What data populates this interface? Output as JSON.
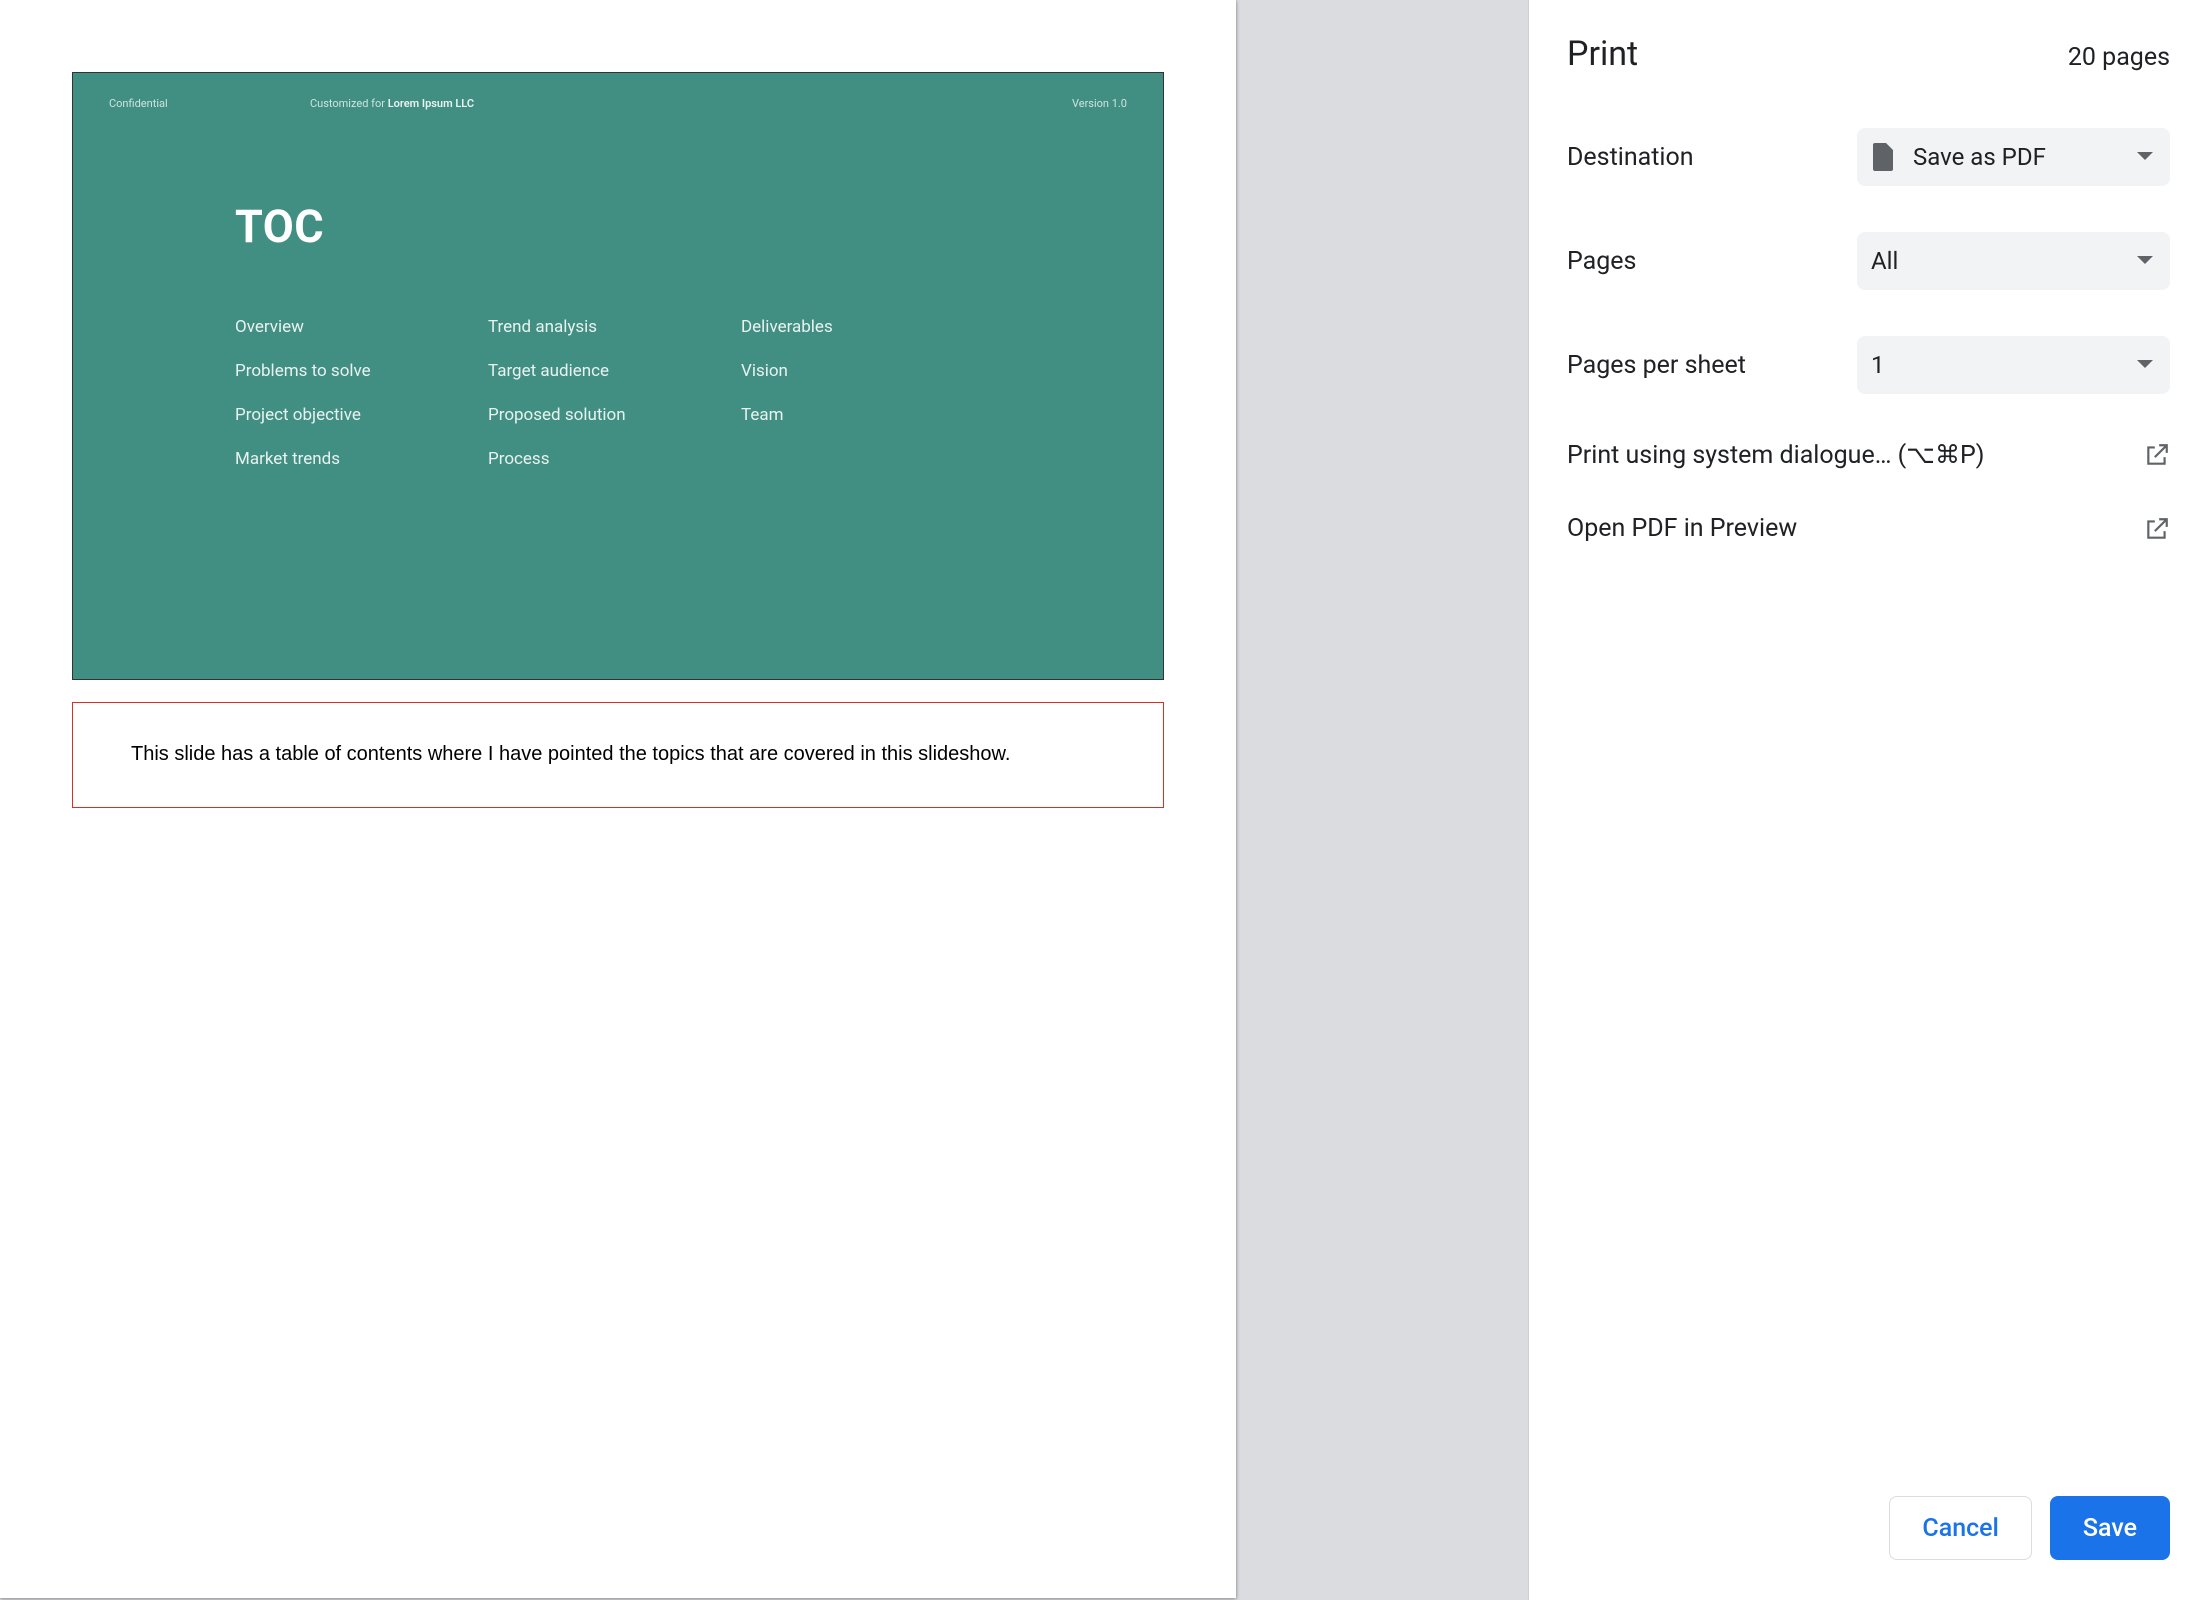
{
  "sidebar": {
    "title": "Print",
    "page_count": "20 pages",
    "options": {
      "destination_label": "Destination",
      "destination_value": "Save as PDF",
      "pages_label": "Pages",
      "pages_value": "All",
      "pps_label": "Pages per sheet",
      "pps_value": "1"
    },
    "links": {
      "system_dialog": "Print using system dialogue… (⌥⌘P)",
      "open_preview": "Open PDF in Preview"
    },
    "buttons": {
      "cancel": "Cancel",
      "save": "Save"
    }
  },
  "preview": {
    "slide": {
      "header_left": "Confidential",
      "header_mid_prefix": "Customized for ",
      "header_mid_bold": "Lorem Ipsum LLC",
      "header_right": "Version 1.0",
      "title": "TOC",
      "col1": [
        "Overview",
        "Problems to solve",
        "Project objective",
        "Market trends"
      ],
      "col2": [
        "Trend analysis",
        "Target audience",
        "Proposed solution",
        "Process"
      ],
      "col3": [
        "Deliverables",
        "Vision",
        "Team"
      ]
    },
    "note": "This slide has a table of contents where I have pointed the topics that are covered in this slideshow."
  }
}
